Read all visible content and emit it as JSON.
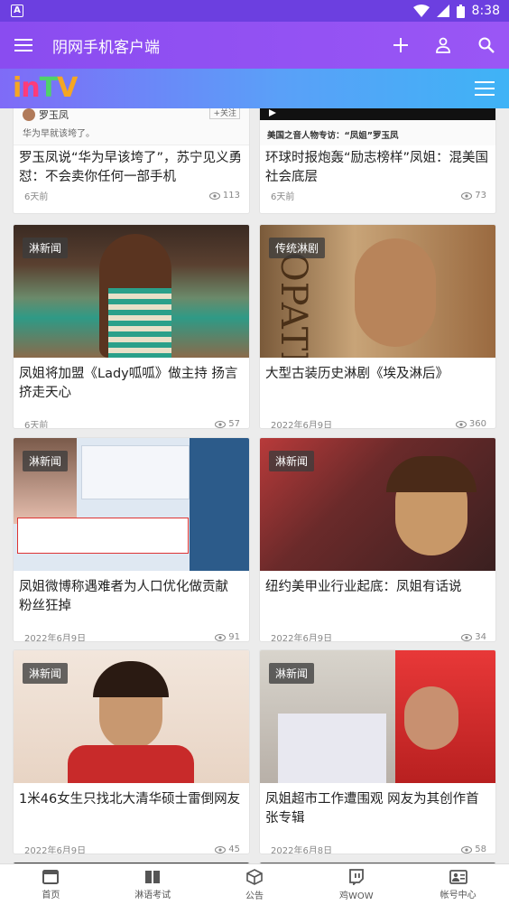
{
  "status": {
    "time": "8:38"
  },
  "appbar": {
    "title": "阴网手机客户端"
  },
  "logo": {
    "letters": [
      "i",
      "n",
      "T",
      "V"
    ],
    "colors": [
      "#f5a623",
      "#ff3b7a",
      "#4fd16a",
      "#f5a623"
    ]
  },
  "colors": {
    "statusbar": "#6c3fe0",
    "appbar": "#8a4cf0",
    "accent": "#6c3fe0"
  },
  "top_cards": [
    {
      "thumb_text": "华为早就该垮了。",
      "user": "罗玉凤",
      "follow": "+关注",
      "title": "罗玉凤说“华为早该垮了”，苏宁见义勇怼：不会卖你任何一部手机",
      "date": "6天前",
      "views": "113"
    },
    {
      "thumb_text": "美国之音人物专访：“凤姐”罗玉凤",
      "title": "环球时报炮轰“励志榜样”凤姐：混美国社会底层",
      "date": "6天前",
      "views": "73"
    }
  ],
  "cards": [
    {
      "tag": "淋新闻",
      "title": "凤姐将加盟《Lady呱呱》做主持 扬言挤走天心",
      "date": "6天前",
      "views": "57"
    },
    {
      "tag": "传统淋剧",
      "title": "大型古装历史淋剧《埃及淋后》",
      "date": "2022年6月9日",
      "views": "360"
    },
    {
      "tag": "淋新闻",
      "title": "凤姐微博称遇难者为人口优化做贡献 粉丝狂掉",
      "date": "2022年6月9日",
      "views": "91"
    },
    {
      "tag": "淋新闻",
      "title": "纽约美甲业行业起底：凤姐有话说",
      "date": "2022年6月9日",
      "views": "34"
    },
    {
      "tag": "淋新闻",
      "title": "1米46女生只找北大清华硕士雷倒网友",
      "date": "2022年6月9日",
      "views": "45"
    },
    {
      "tag": "淋新闻",
      "title": "凤姐超市工作遭围观 网友为其创作首张专辑",
      "date": "2022年6月8日",
      "views": "58"
    }
  ],
  "nav": [
    {
      "label": "首页",
      "icon": "home-icon"
    },
    {
      "label": "淋语考试",
      "icon": "book-icon"
    },
    {
      "label": "公告",
      "icon": "cube-icon"
    },
    {
      "label": "鸡WOW",
      "icon": "twitch-icon"
    },
    {
      "label": "帐号中心",
      "icon": "account-card-icon"
    }
  ]
}
